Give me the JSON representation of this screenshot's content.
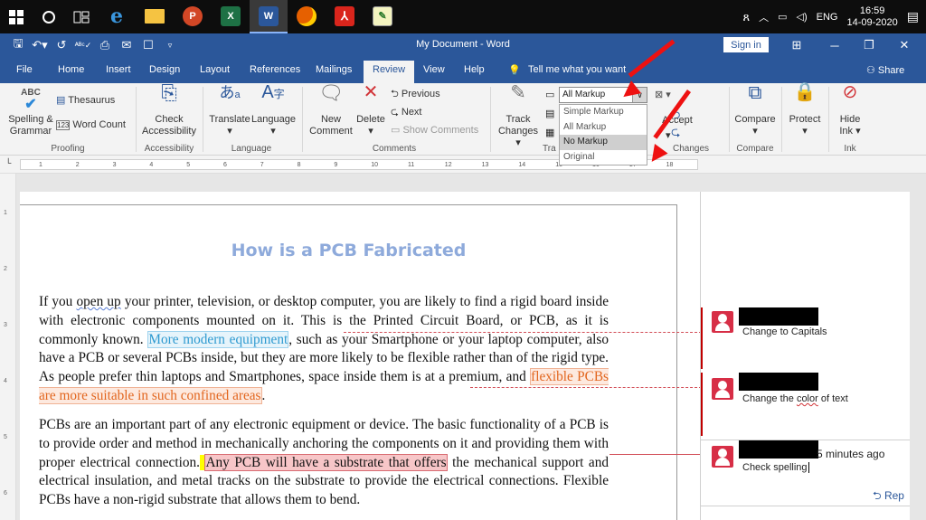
{
  "taskbar": {
    "icons": [
      "windows-start-icon",
      "cortana-circle-icon",
      "task-view-icon",
      "edge-icon",
      "file-explorer-icon",
      "powerpoint-icon",
      "excel-icon",
      "word-icon",
      "firefox-icon",
      "acrobat-icon",
      "notepad-icon"
    ],
    "tray": {
      "lang": "ENG",
      "time": "16:59",
      "date": "14-09-2020"
    }
  },
  "window": {
    "title": "My Document - Word",
    "sign_in": "Sign in"
  },
  "tabs": [
    "File",
    "Home",
    "Insert",
    "Design",
    "Layout",
    "References",
    "Mailings",
    "Review",
    "View",
    "Help"
  ],
  "active_tab": "Review",
  "tell_me": "Tell me what you want",
  "share": "Share",
  "ribbon": {
    "proofing": {
      "spelling": "Spelling &",
      "grammar": "Grammar",
      "thesaurus": "Thesaurus",
      "word_count": "Word Count",
      "abc": "ABC",
      "group": "Proofing"
    },
    "accessibility": {
      "check": "Check",
      "access": "Accessibility",
      "group": "Accessibility"
    },
    "language": {
      "translate": "Translate",
      "language": "Language",
      "group": "Language"
    },
    "comments": {
      "new": "New",
      "comment": "Comment",
      "delete": "Delete",
      "previous": "Previous",
      "next": "Next",
      "show": "Show Comments",
      "group": "Comments"
    },
    "tracking": {
      "track": "Track",
      "changes": "Changes",
      "markup_value": "All Markup",
      "group_partial": "Tra"
    },
    "markup_options": [
      "Simple Markup",
      "All Markup",
      "No Markup",
      "Original"
    ],
    "changes": {
      "accept": "Accept",
      "group": "Changes"
    },
    "compare": {
      "label": "Compare",
      "group": "Compare"
    },
    "protect": {
      "label": "Protect"
    },
    "ink": {
      "hide": "Hide",
      "ink": "Ink",
      "group": "Ink"
    }
  },
  "ruler_labels": [
    "1",
    "2",
    "3",
    "4",
    "5",
    "6",
    "7",
    "8",
    "9",
    "10",
    "11",
    "12",
    "13",
    "14",
    "15",
    "16",
    "17",
    "18"
  ],
  "vruler_labels": [
    "1",
    "2",
    "3",
    "4",
    "5",
    "6"
  ],
  "document": {
    "heading": "How is a PCB Fabricated",
    "p1": {
      "t1": "If you ",
      "open_up": "open up",
      "t2": " your printer, television, or desktop computer, you are likely to find a rigid board inside with electronic components mounted on it. This is the Printed Circuit Board, or PCB, as it is commonly known. ",
      "inserted": "More modern equipment",
      "t3": ", such as your Smartphone or your laptop computer, also have a PCB or several PCBs inside, but they are more likely to be flexible rather than of the rigid type. As people prefer thin laptops and Smartphones, space inside them is at a premium, and ",
      "highlighted": "flexible PCBs are more suitable in such confined areas",
      "t4": "."
    },
    "p2": {
      "t1": "PCBs are an important part of any electronic equipment or device. The basic functionality of a PCB is to provide order and method in mechanically anchoring the components on it and providing them with proper electrical connection.",
      "commented": "Any PCB will have a substrate that offers",
      "t2": " the mechanical support and electrical insulation, and metal tracks on the substrate to provide the electrical connections. Flexible PCBs have a non-rigid substrate that allows them to bend."
    }
  },
  "comments": [
    {
      "text": "Change to Capitals",
      "meta": ""
    },
    {
      "text_before": "Change the ",
      "text_wavy": "color",
      "text_after": " of text",
      "meta": ""
    },
    {
      "text": "Check spelling",
      "meta": "5 minutes ago"
    }
  ],
  "reply_label": "Rep",
  "colors": {
    "title_bar": "#2b579a",
    "insertion": "#2e9ad0",
    "deletion": "#e2661f",
    "comment_avatar": "#d72e46",
    "annotation_arrow": "#ee1111"
  }
}
